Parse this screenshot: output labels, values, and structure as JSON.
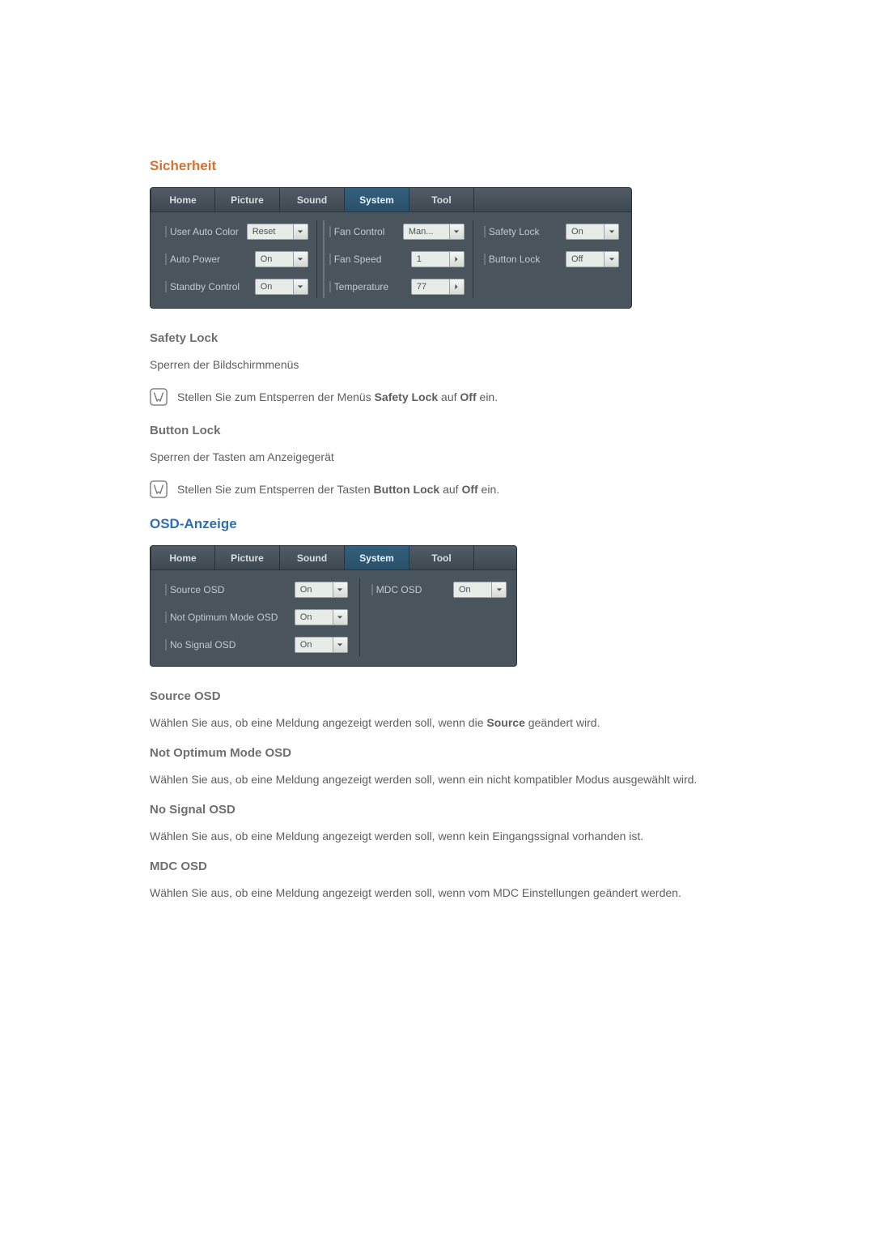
{
  "headings": {
    "security": "Sicherheit",
    "osd": "OSD-Anzeige"
  },
  "securityPanel": {
    "tabs": {
      "home": "Home",
      "picture": "Picture",
      "sound": "Sound",
      "system": "System",
      "tool": "Tool"
    },
    "userAutoColor": {
      "label": "User Auto Color",
      "value": "Reset"
    },
    "autoPower": {
      "label": "Auto Power",
      "value": "On"
    },
    "standbyControl": {
      "label": "Standby Control",
      "value": "On"
    },
    "fanControl": {
      "label": "Fan Control",
      "value": "Man..."
    },
    "fanSpeed": {
      "label": "Fan Speed",
      "value": "1"
    },
    "temperature": {
      "label": "Temperature",
      "value": "77"
    },
    "safetyLock": {
      "label": "Safety Lock",
      "value": "On"
    },
    "buttonLock": {
      "label": "Button Lock",
      "value": "Off"
    }
  },
  "safetyLockSection": {
    "title": "Safety Lock",
    "desc": "Sperren der Bildschirmmenüs",
    "notePre": "Stellen Sie zum Entsperren der Menüs ",
    "noteStrong": "Safety Lock",
    "noteMid": " auf ",
    "noteStrong2": "Off",
    "notePost": " ein."
  },
  "buttonLockSection": {
    "title": "Button Lock",
    "desc": "Sperren der Tasten am Anzeigegerät",
    "notePre": "Stellen Sie zum Entsperren der Tasten ",
    "noteStrong": "Button Lock",
    "noteMid": " auf ",
    "noteStrong2": "Off",
    "notePost": " ein."
  },
  "osdPanel": {
    "tabs": {
      "home": "Home",
      "picture": "Picture",
      "sound": "Sound",
      "system": "System",
      "tool": "Tool"
    },
    "sourceOSD": {
      "label": "Source OSD",
      "value": "On"
    },
    "notOptimum": {
      "label": "Not Optimum Mode OSD",
      "value": "On"
    },
    "noSignal": {
      "label": "No Signal OSD",
      "value": "On"
    },
    "mdcOSD": {
      "label": "MDC OSD",
      "value": "On"
    }
  },
  "sourceOSD": {
    "title": "Source OSD",
    "descPre": "Wählen Sie aus, ob eine Meldung angezeigt werden soll, wenn die ",
    "descStrong": "Source",
    "descPost": " geändert wird."
  },
  "notOptimum": {
    "title": "Not Optimum Mode OSD",
    "desc": "Wählen Sie aus, ob eine Meldung angezeigt werden soll, wenn ein nicht kompatibler Modus ausgewählt wird."
  },
  "noSignal": {
    "title": "No Signal OSD",
    "desc": "Wählen Sie aus, ob eine Meldung angezeigt werden soll, wenn kein Eingangssignal vorhanden ist."
  },
  "mdcOSD": {
    "title": "MDC OSD",
    "desc": "Wählen Sie aus, ob eine Meldung angezeigt werden soll, wenn vom MDC Einstellungen geändert werden."
  }
}
